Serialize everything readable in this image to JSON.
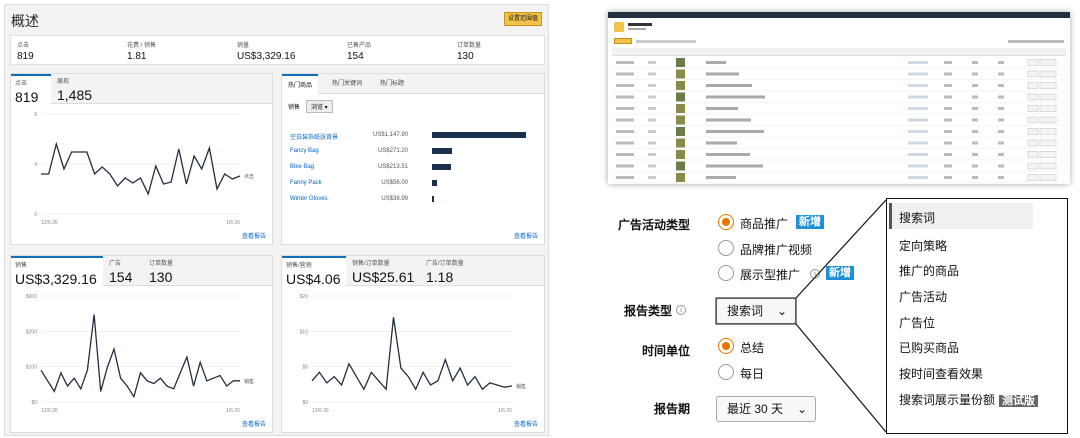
{
  "overview": {
    "title": "概述",
    "action_button": "设置范围值",
    "kpis": [
      {
        "label": "点击",
        "value": "819"
      },
      {
        "label": "花费 / 销售",
        "value": "1.81"
      },
      {
        "label": "销量",
        "value": "US$3,329.16"
      },
      {
        "label": "已售产品",
        "value": "154"
      },
      {
        "label": "订单数量",
        "value": "130"
      }
    ]
  },
  "card1": {
    "tabs": [
      {
        "label": "点击",
        "value": "819"
      },
      {
        "label": "展现",
        "value": "1,485"
      }
    ],
    "legend": "点击",
    "x_start": "12/6 26",
    "x_end": "1/6 26",
    "link": "查看报告",
    "chart_data": {
      "type": "line",
      "yticks": [
        "8",
        "4",
        "0"
      ],
      "ylim": [
        0,
        10
      ],
      "values": [
        4,
        4,
        7,
        4.5,
        6.2,
        6.2,
        6.2,
        4,
        4.7,
        4,
        2.8,
        3.6,
        3.1,
        3.6,
        2,
        4.8,
        3,
        3.2,
        6.5,
        3,
        5.8,
        4.5,
        6.6,
        2.5,
        4,
        3.5,
        3.8
      ]
    }
  },
  "products": {
    "tabs": [
      "热门商品",
      "热门关键词",
      "热门标题"
    ],
    "subtabs": [
      "销售",
      "浏览"
    ],
    "rows": [
      {
        "name": "空白装饰纸张背景",
        "value": "US$1,147.90",
        "ratio": 1.0
      },
      {
        "name": "Fancy Bag",
        "value": "US$271.20",
        "ratio": 0.21
      },
      {
        "name": "Bike Bag",
        "value": "US$213.51",
        "ratio": 0.2
      },
      {
        "name": "Fanny Pack",
        "value": "US$56.00",
        "ratio": 0.05
      },
      {
        "name": "Winter Gloves",
        "value": "US$38.99",
        "ratio": 0.02
      }
    ],
    "link": "查看报告"
  },
  "card3": {
    "tabs": [
      {
        "label": "销售",
        "value": "US$3,329.16"
      },
      {
        "label": "广告",
        "value": "154"
      },
      {
        "label": "订单数量",
        "value": "130"
      }
    ],
    "legend": "销售",
    "x_start": "12/6 26",
    "x_end": "1/6 26",
    "link": "查看报告",
    "chart_data": {
      "type": "line",
      "yticks": [
        "$300",
        "$200",
        "$100",
        "$0"
      ],
      "ylim": [
        0,
        400
      ],
      "values": [
        120,
        80,
        40,
        110,
        60,
        90,
        50,
        120,
        330,
        40,
        130,
        200,
        90,
        60,
        20,
        110,
        80,
        70,
        90,
        60,
        50,
        110,
        170,
        60,
        150,
        80,
        90,
        100,
        60,
        80,
        80
      ]
    }
  },
  "card4": {
    "tabs": [
      {
        "label": "销售/营销",
        "value": "US$4.06"
      },
      {
        "label": "销售/订单数量",
        "value": "US$25.61"
      },
      {
        "label": "广告/订单数量",
        "value": "1.18"
      }
    ],
    "legend": "销售",
    "x_start": "12/6 26",
    "x_end": "1/6 26",
    "link": "查看报告",
    "chart_data": {
      "type": "line",
      "yticks": [
        "$20",
        "$10",
        "$5",
        "$0"
      ],
      "ylim": [
        0,
        25
      ],
      "values": [
        5,
        7,
        4.5,
        6,
        4,
        9,
        6,
        3,
        7,
        5,
        3,
        20,
        8,
        6,
        3,
        7,
        4,
        5,
        10,
        5,
        8,
        4,
        6,
        3,
        4.5,
        4,
        3.5,
        3.8
      ]
    }
  },
  "report_form": {
    "campaign_type_label": "广告活动类型",
    "campaign_types": [
      {
        "label": "商品推广",
        "selected": true,
        "badge": "新增"
      },
      {
        "label": "品牌推广视频",
        "selected": false,
        "badge": ""
      },
      {
        "label": "展示型推广",
        "selected": false,
        "badge": "新增"
      }
    ],
    "report_type_label": "报告类型",
    "report_type_value": "搜索词",
    "time_unit_label": "时间单位",
    "time_units": [
      {
        "label": "总结",
        "selected": true
      },
      {
        "label": "每日",
        "selected": false
      }
    ],
    "period_label": "报告期",
    "period_value": "最近 30 天"
  },
  "dropdown": {
    "items": [
      "搜索词",
      "定向策略",
      "推广的商品",
      "广告活动",
      "广告位",
      "已购买商品",
      "按时间查看效果",
      "搜索词展示量份额"
    ],
    "beta_badge": "测试版"
  },
  "colors": {
    "accent": "#e77600",
    "line": "#232f3e",
    "badge": "#1f8fd6"
  }
}
